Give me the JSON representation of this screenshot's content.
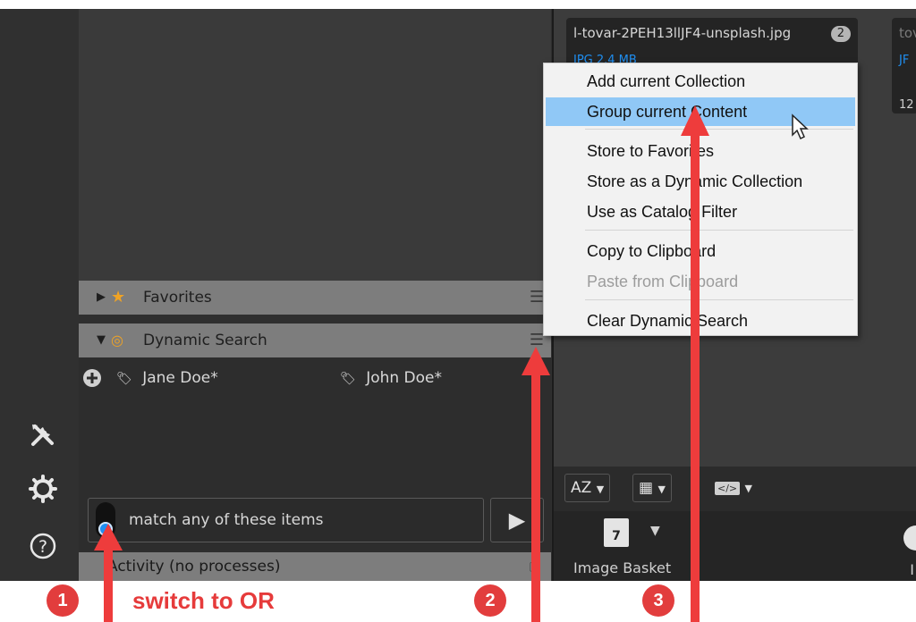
{
  "left_toolbar": {
    "tools_icon": "tools-icon",
    "settings_icon": "gear-icon",
    "help_icon": "help-icon",
    "help_glyph": "?"
  },
  "panel": {
    "favorites": {
      "label": "Favorites",
      "expanded": false
    },
    "dynamic_search": {
      "label": "Dynamic Search",
      "expanded": true
    },
    "tags": [
      "Jane Doe*",
      "John Doe*"
    ],
    "search_placeholder": "match any of these items",
    "activity_label": "Activity (no processes)"
  },
  "thumbnails": [
    {
      "title": "l-tovar-2PEH13llJF4-unsplash.jpg",
      "badge": "2",
      "meta": "JPG 2.4 MB"
    },
    {
      "title": "tov",
      "badge": "",
      "meta": "JF"
    }
  ],
  "thumb_extra": "12",
  "sort_bar": {
    "sort_label": "AZ",
    "view_label": "grid",
    "code_label": "</>"
  },
  "basket": {
    "label": "Image Basket",
    "day": "7",
    "right_char": "I"
  },
  "context_menu": {
    "items": [
      {
        "label": "Add current Collection",
        "state": "normal"
      },
      {
        "label": "Group current Content",
        "state": "highlighted"
      },
      {
        "label": "Store to Favorites",
        "state": "normal"
      },
      {
        "label": "Store as a Dynamic Collection",
        "state": "normal"
      },
      {
        "label": "Use as Catalog Filter",
        "state": "normal"
      },
      {
        "label": "Copy to Clipboard",
        "state": "normal"
      },
      {
        "label": "Paste from Clipboard",
        "state": "disabled"
      },
      {
        "label": "Clear Dynamic Search",
        "state": "normal"
      }
    ]
  },
  "annotations": {
    "markers": [
      "1",
      "2",
      "3"
    ],
    "text": "switch to OR",
    "color": "#e23d3d"
  },
  "colors": {
    "accent": "#1f8ff2",
    "menu_highlight": "#90c8f6",
    "header_bg": "#7d7d7d"
  }
}
